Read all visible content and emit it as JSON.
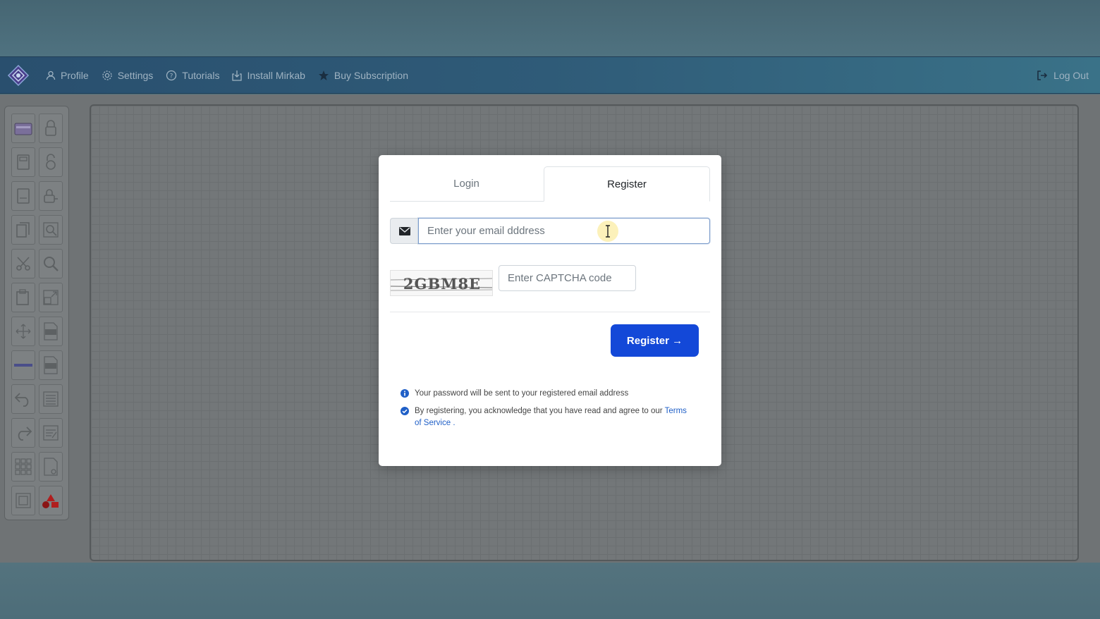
{
  "nav": {
    "items": [
      {
        "label": "Profile",
        "icon": "user-icon"
      },
      {
        "label": "Settings",
        "icon": "gear-icon"
      },
      {
        "label": "Tutorials",
        "icon": "question-circle-icon"
      },
      {
        "label": "Install Mirkab",
        "icon": "install-icon"
      },
      {
        "label": "Buy Subscription",
        "icon": "star-icon"
      }
    ],
    "logout_label": "Log Out"
  },
  "modal": {
    "tabs": {
      "login": "Login",
      "register": "Register"
    },
    "email_placeholder": "Enter your email dddress",
    "captcha_text": "2GBM8E",
    "captcha_placeholder": "Enter CAPTCHA code",
    "register_button": "Register →",
    "note_password": "Your password will be sent to your registered email address",
    "note_terms_prefix": "By registering, you acknowledge that you have read and agree to our ",
    "note_terms_link": "Terms of Service",
    "note_terms_suffix": " ."
  },
  "colors": {
    "primary_button": "#1348d8",
    "link": "#1f5fc7",
    "navbar": "#2f5b78"
  }
}
